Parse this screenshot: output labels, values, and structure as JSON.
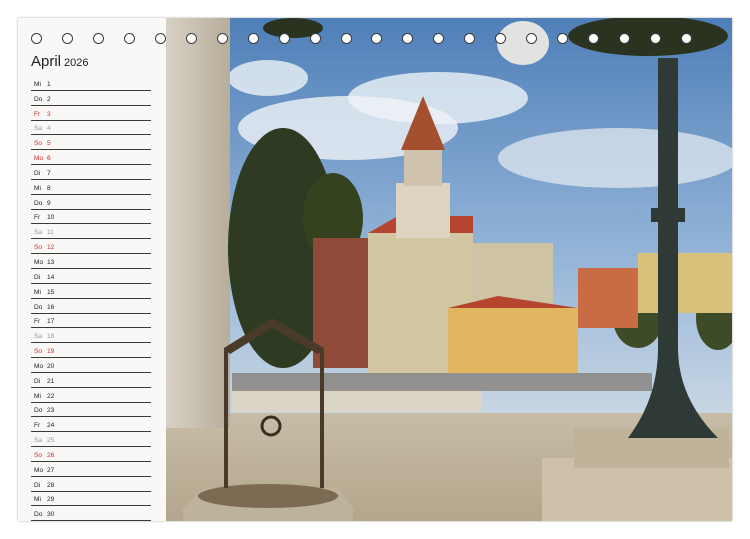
{
  "calendar": {
    "month": "April",
    "year": "2026",
    "days": [
      {
        "wd": "Mi",
        "d": "1",
        "type": "normal"
      },
      {
        "wd": "Do",
        "d": "2",
        "type": "normal"
      },
      {
        "wd": "Fr",
        "d": "3",
        "type": "hol"
      },
      {
        "wd": "Sa",
        "d": "4",
        "type": "sat"
      },
      {
        "wd": "So",
        "d": "5",
        "type": "sun"
      },
      {
        "wd": "Mo",
        "d": "6",
        "type": "hol"
      },
      {
        "wd": "Di",
        "d": "7",
        "type": "normal"
      },
      {
        "wd": "Mi",
        "d": "8",
        "type": "normal"
      },
      {
        "wd": "Do",
        "d": "9",
        "type": "normal"
      },
      {
        "wd": "Fr",
        "d": "10",
        "type": "normal"
      },
      {
        "wd": "Sa",
        "d": "11",
        "type": "sat"
      },
      {
        "wd": "So",
        "d": "12",
        "type": "sun"
      },
      {
        "wd": "Mo",
        "d": "13",
        "type": "normal"
      },
      {
        "wd": "Di",
        "d": "14",
        "type": "normal"
      },
      {
        "wd": "Mi",
        "d": "15",
        "type": "normal"
      },
      {
        "wd": "Do",
        "d": "16",
        "type": "normal"
      },
      {
        "wd": "Fr",
        "d": "17",
        "type": "normal"
      },
      {
        "wd": "Sa",
        "d": "18",
        "type": "sat"
      },
      {
        "wd": "So",
        "d": "19",
        "type": "sun"
      },
      {
        "wd": "Mo",
        "d": "20",
        "type": "normal"
      },
      {
        "wd": "Di",
        "d": "21",
        "type": "normal"
      },
      {
        "wd": "Mi",
        "d": "22",
        "type": "normal"
      },
      {
        "wd": "Do",
        "d": "23",
        "type": "normal"
      },
      {
        "wd": "Fr",
        "d": "24",
        "type": "normal"
      },
      {
        "wd": "Sa",
        "d": "25",
        "type": "sat"
      },
      {
        "wd": "So",
        "d": "26",
        "type": "sun"
      },
      {
        "wd": "Mo",
        "d": "27",
        "type": "normal"
      },
      {
        "wd": "Di",
        "d": "28",
        "type": "normal"
      },
      {
        "wd": "Mi",
        "d": "29",
        "type": "normal"
      },
      {
        "wd": "Do",
        "d": "30",
        "type": "normal"
      }
    ]
  },
  "binding": {
    "ring_count": 22
  },
  "colors": {
    "sunday_holiday": "#d62828",
    "saturday": "#9a9a9a",
    "text": "#222222"
  }
}
